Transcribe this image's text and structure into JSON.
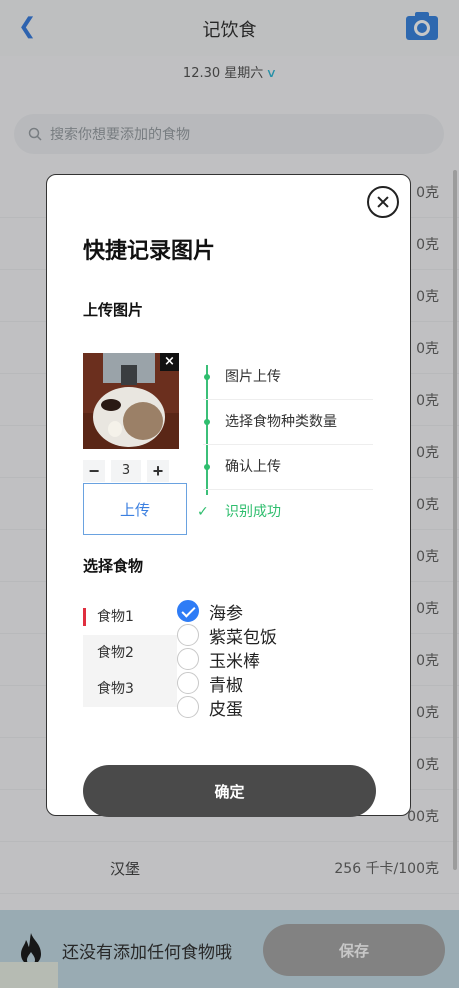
{
  "header": {
    "title": "记饮食",
    "back_icon": "chevron-left-icon",
    "camera_icon": "camera-icon"
  },
  "date": {
    "label": "12.30 星期六"
  },
  "search": {
    "placeholder": "搜索你想要添加的食物"
  },
  "food_list": [
    {
      "name": "",
      "kcal": "0克"
    },
    {
      "name": "",
      "kcal": "0克"
    },
    {
      "name": "",
      "kcal": "0克"
    },
    {
      "name": "",
      "kcal": "0克"
    },
    {
      "name": "",
      "kcal": "0克"
    },
    {
      "name": "",
      "kcal": "0克"
    },
    {
      "name": "",
      "kcal": "0克"
    },
    {
      "name": "",
      "kcal": "0克"
    },
    {
      "name": "",
      "kcal": "0克"
    },
    {
      "name": "",
      "kcal": "0克"
    },
    {
      "name": "",
      "kcal": "0克"
    },
    {
      "name": "",
      "kcal": "0克"
    },
    {
      "name": "",
      "kcal": "00克"
    },
    {
      "name": "汉堡",
      "kcal": "256 千卡/100克"
    }
  ],
  "bottom": {
    "empty_text": "还没有添加任何食物哦",
    "save_label": "保存"
  },
  "modal": {
    "title": "快捷记录图片",
    "upload_section_title": "上传图片",
    "quantity": "3",
    "minus": "−",
    "plus": "+",
    "upload_button": "上传",
    "thumb_close": "×",
    "steps": [
      "图片上传",
      "选择食物种类数量",
      "确认上传",
      "识别成功"
    ],
    "choose_section_title": "选择食物",
    "food_tabs": [
      "食物1",
      "食物2",
      "食物3"
    ],
    "options": [
      {
        "label": "海参",
        "checked": true
      },
      {
        "label": "紫菜包饭",
        "checked": false
      },
      {
        "label": "玉米棒",
        "checked": false
      },
      {
        "label": "青椒",
        "checked": false
      },
      {
        "label": "皮蛋",
        "checked": false
      }
    ],
    "confirm_button": "确定"
  },
  "colors": {
    "accent": "#3b7fe0",
    "success": "#2fbe6e",
    "marker": "#e02f3f",
    "check": "#2e7cf6"
  }
}
